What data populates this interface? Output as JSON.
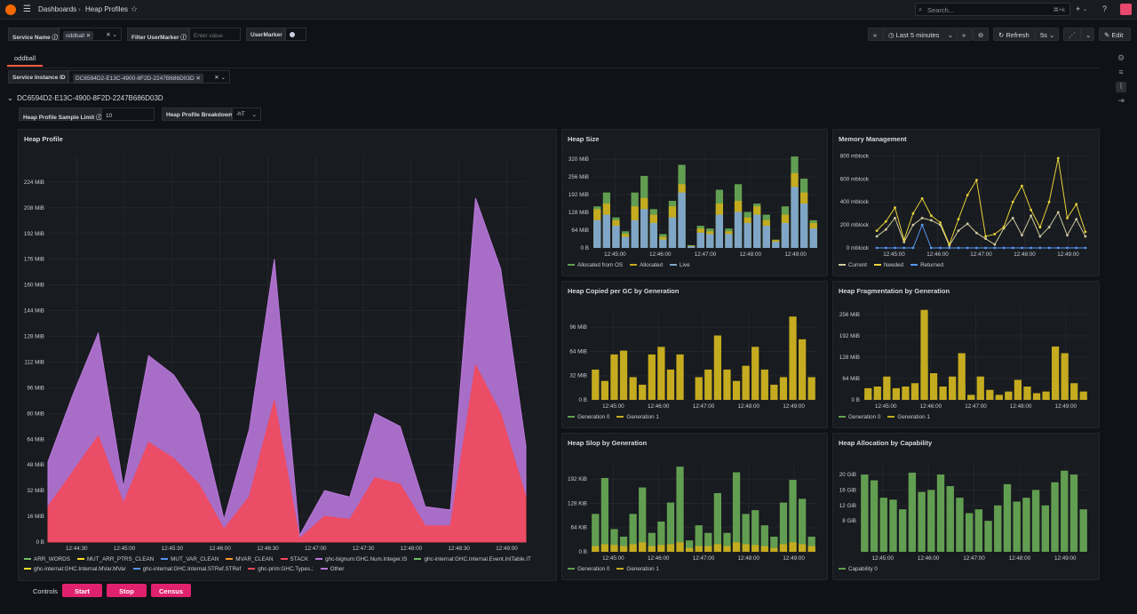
{
  "topbar": {
    "crumb_dashboards": "Dashboards",
    "crumb_sep": "›",
    "crumb_page": "Heap Profiles",
    "search_placeholder": "Search...",
    "search_shortcut": "⌘+k",
    "plus": "+",
    "help": "?"
  },
  "variables": {
    "service_name_label": "Service Name",
    "service_name_value": "oddball",
    "filter_usermarker_label": "Filter UserMarker",
    "filter_usermarker_placeholder": "Enter value",
    "usermarker_label": "UserMarker",
    "service_instance_label": "Service Instance ID",
    "service_instance_value": "DC6594D2-E13C-4900-8F2D-2247B686D03D"
  },
  "toolbar": {
    "time_range": "Last 5 minutes",
    "refresh_label": "Refresh",
    "refresh_interval": "5s",
    "edit_label": "Edit"
  },
  "tabs": [
    {
      "label": "oddball"
    }
  ],
  "row": {
    "title": "DC6594D2-E13C-4900-8F2D-2247B686D03D",
    "sample_limit_label": "Heap Profile Sample Limit",
    "sample_limit_value": "10",
    "breakdown_label": "Heap Profile Breakdown",
    "breakdown_value": "-hT"
  },
  "controls": {
    "label": "Controls",
    "start": "Start",
    "stop": "Stop",
    "census": "Census"
  },
  "colors": {
    "green": "#629e51",
    "yellow": "#c5ab1f",
    "blue": "#7fa6c7",
    "red": "#f2495c",
    "purple": "#b877d9"
  },
  "chart_data": [
    {
      "id": "heap-profile",
      "type": "area",
      "title": "Heap Profile",
      "x": [
        "12:44:30",
        "12:45:00",
        "12:45:30",
        "12:46:00",
        "12:46:30",
        "12:47:00",
        "12:47:30",
        "12:48:00",
        "12:48:30",
        "12:49:00"
      ],
      "ylim": [
        0,
        240
      ],
      "yticks": [
        "0 B",
        "16 MiB",
        "32 MiB",
        "48 MiB",
        "64 MiB",
        "80 MiB",
        "96 MiB",
        "112 MiB",
        "128 MiB",
        "144 MiB",
        "160 MiB",
        "176 MiB",
        "192 MiB",
        "208 MiB",
        "224 MiB"
      ],
      "series": [
        {
          "name": "STACK",
          "color": "#f2495c",
          "values": [
            22,
            44,
            66,
            24,
            62,
            52,
            36,
            8,
            28,
            88,
            2,
            16,
            14,
            40,
            36,
            10,
            10,
            110,
            80,
            28
          ]
        },
        {
          "name": "ghc-bignum:GHC.Num.Integer.IS",
          "color": "#b877d9",
          "values": [
            50,
            92,
            130,
            34,
            116,
            104,
            80,
            14,
            70,
            176,
            4,
            32,
            28,
            80,
            72,
            22,
            20,
            214,
            170,
            60
          ]
        }
      ],
      "legend": [
        "ARR_WORDS",
        "MUT_ARR_PTRS_CLEAN",
        "MUT_VAR_CLEAN",
        "MVAR_CLEAN",
        "STACK",
        "ghc-bignum:GHC.Num.Integer.IS",
        "ghc-internal:GHC.Internal.Event.IntTable.IT",
        "ghc-internal:GHC.Internal.MVar.MVar",
        "ghc-internal:GHC.Internal.STRef.STRef",
        "ghc-prim:GHC.Types.;",
        "Other"
      ],
      "legend_colors": [
        "#73bf69",
        "#fade2a",
        "#5794f2",
        "#ff9830",
        "#f2495c",
        "#b877d9",
        "#73bf69",
        "#fade2a",
        "#5794f2",
        "#f2495c",
        "#b877d9"
      ]
    },
    {
      "id": "heap-size",
      "type": "bar",
      "title": "Heap Size",
      "x": [
        "12:45:00",
        "12:46:00",
        "12:47:00",
        "12:48:00",
        "12:49:00"
      ],
      "ylim": [
        0,
        340
      ],
      "yticks": [
        "0 B",
        "64 MiB",
        "128 MiB",
        "192 MiB",
        "256 MiB",
        "320 MiB"
      ],
      "series": [
        {
          "name": "Allocated from OS",
          "color": "#629e51",
          "values": [
            150,
            200,
            110,
            60,
            200,
            260,
            140,
            50,
            170,
            300,
            10,
            80,
            70,
            210,
            70,
            230,
            130,
            160,
            120,
            30,
            150,
            330,
            250,
            100
          ]
        },
        {
          "name": "Allocated",
          "color": "#c5ab1f",
          "values": [
            140,
            160,
            100,
            50,
            150,
            180,
            120,
            40,
            150,
            230,
            8,
            70,
            60,
            160,
            60,
            170,
            110,
            150,
            100,
            28,
            120,
            270,
            200,
            90
          ]
        },
        {
          "name": "Live",
          "color": "#7fa6c7",
          "values": [
            100,
            120,
            80,
            40,
            100,
            140,
            90,
            30,
            110,
            200,
            6,
            55,
            50,
            120,
            50,
            130,
            90,
            120,
            80,
            22,
            90,
            220,
            160,
            70
          ]
        }
      ]
    },
    {
      "id": "memory-management",
      "type": "line",
      "title": "Memory Management",
      "x": [
        "12:45:00",
        "12:46:00",
        "12:47:00",
        "12:48:00",
        "12:49:00"
      ],
      "ylim": [
        0,
        850
      ],
      "yticks": [
        "0 mblock",
        "200 mblock",
        "400 mblock",
        "600 mblock",
        "800 mblock"
      ],
      "series": [
        {
          "name": "Current",
          "color": "#cfc9a0",
          "values": [
            100,
            160,
            260,
            50,
            200,
            260,
            240,
            200,
            20,
            150,
            210,
            130,
            80,
            30,
            170,
            260,
            110,
            280,
            100,
            180,
            310,
            110,
            250,
            100
          ]
        },
        {
          "name": "Needed",
          "color": "#e8d23a",
          "values": [
            150,
            230,
            350,
            70,
            300,
            430,
            280,
            220,
            30,
            250,
            460,
            590,
            100,
            120,
            180,
            400,
            540,
            330,
            180,
            400,
            780,
            260,
            380,
            140
          ]
        },
        {
          "name": "Returned",
          "color": "#5794f2",
          "values": [
            0,
            0,
            0,
            0,
            0,
            200,
            0,
            0,
            0,
            0,
            0,
            0,
            0,
            0,
            0,
            0,
            0,
            0,
            0,
            0,
            0,
            0,
            0,
            0
          ]
        }
      ]
    },
    {
      "id": "heap-copied",
      "type": "bar",
      "title": "Heap Copied per GC by Generation",
      "x": [
        "12:45:00",
        "12:46:00",
        "12:47:00",
        "12:48:00",
        "12:49:00"
      ],
      "ylim": [
        0,
        115
      ],
      "yticks": [
        "0 B",
        "32 MiB",
        "64 MiB",
        "96 MiB"
      ],
      "series": [
        {
          "name": "Generation 0",
          "color": "#629e51",
          "values": [
            0,
            0,
            0,
            0,
            0,
            0,
            0,
            0,
            0,
            0,
            0,
            0,
            0,
            0,
            0,
            0,
            0,
            0,
            0,
            0,
            0,
            0,
            0,
            0
          ]
        },
        {
          "name": "Generation 1",
          "color": "#c5ab1f",
          "values": [
            40,
            25,
            60,
            65,
            30,
            20,
            60,
            70,
            40,
            60,
            0,
            30,
            40,
            85,
            40,
            25,
            45,
            70,
            40,
            20,
            30,
            110,
            80,
            30
          ]
        }
      ]
    },
    {
      "id": "heap-fragmentation",
      "type": "bar",
      "title": "Heap Fragmentation by Generation",
      "x": [
        "12:45:00",
        "12:46:00",
        "12:47:00",
        "12:48:00",
        "12:49:00"
      ],
      "ylim": [
        0,
        280
      ],
      "yticks": [
        "0 B",
        "64 MiB",
        "128 MiB",
        "192 MiB",
        "256 MiB"
      ],
      "series": [
        {
          "name": "Generation 0",
          "color": "#629e51",
          "values": [
            10,
            14,
            30,
            10,
            12,
            30,
            110,
            16,
            10,
            30,
            50,
            10,
            10,
            8,
            10,
            20,
            30,
            12,
            10,
            8,
            40,
            50,
            20,
            8
          ]
        },
        {
          "name": "Generation 1",
          "color": "#c5ab1f",
          "values": [
            35,
            40,
            70,
            35,
            40,
            50,
            270,
            80,
            40,
            70,
            140,
            15,
            70,
            30,
            15,
            25,
            60,
            40,
            20,
            25,
            160,
            140,
            50,
            25
          ]
        }
      ]
    },
    {
      "id": "heap-slop",
      "type": "bar",
      "title": "Heap Slop by Generation",
      "x": [
        "12:45:00",
        "12:46:00",
        "12:47:00",
        "12:48:00",
        "12:49:00"
      ],
      "ylim": [
        0,
        230
      ],
      "yticks": [
        "0 B",
        "64 KiB",
        "128 KiB",
        "192 KiB"
      ],
      "series": [
        {
          "name": "Generation 0",
          "color": "#629e51",
          "values": [
            100,
            195,
            60,
            40,
            100,
            170,
            50,
            80,
            130,
            225,
            30,
            70,
            50,
            155,
            50,
            210,
            100,
            110,
            70,
            40,
            130,
            190,
            140,
            40
          ]
        },
        {
          "name": "Generation 1",
          "color": "#c5ab1f",
          "values": [
            15,
            20,
            18,
            15,
            20,
            25,
            15,
            18,
            20,
            25,
            10,
            15,
            15,
            20,
            15,
            25,
            20,
            18,
            15,
            10,
            20,
            25,
            20,
            15
          ]
        }
      ]
    },
    {
      "id": "heap-allocation",
      "type": "bar",
      "title": "Heap Allocation by Capability",
      "x": [
        "12:45:00",
        "12:46:00",
        "12:47:00",
        "12:48:00",
        "12:49:00"
      ],
      "ylim": [
        0,
        23
      ],
      "yticks": [
        "8 GiB",
        "12 GiB",
        "16 GiB",
        "20 GiB"
      ],
      "ytick_values": [
        8,
        12,
        16,
        20
      ],
      "series": [
        {
          "name": "Capability 0",
          "color": "#629e51",
          "values": [
            20,
            18.5,
            14,
            13.5,
            11,
            20.5,
            15.5,
            16,
            20,
            17,
            14,
            10,
            11,
            8,
            12,
            17.5,
            13,
            14,
            16,
            12,
            18,
            21,
            20,
            11
          ]
        }
      ]
    }
  ]
}
